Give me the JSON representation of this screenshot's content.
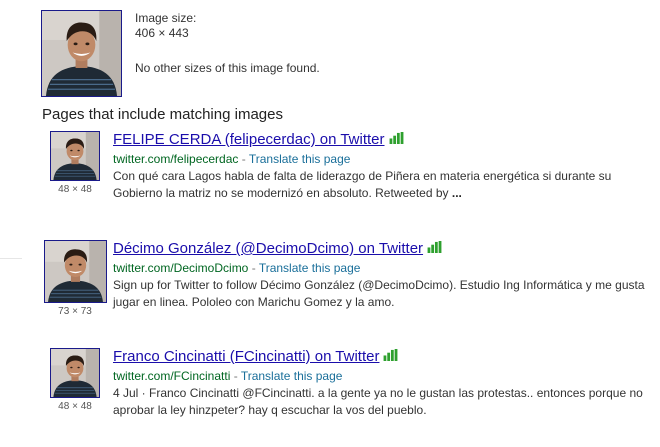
{
  "image_info": {
    "size_label": "Image size:",
    "dimensions": "406 × 443",
    "other_sizes": "No other sizes of this image found."
  },
  "section_title": "Pages that include matching images",
  "colors": {
    "link": "#1a0dab",
    "url_green": "#006621",
    "signal_green": "#2ea02e"
  },
  "icons": [
    "signal-bars-icon"
  ],
  "results": [
    {
      "title": "FELIPE CERDA (felipecerdac) on Twitter",
      "url": "twitter.com/felipecerdac",
      "separator": " - ",
      "translate": "Translate this page",
      "snippet": "Con qué cara Lagos habla de falta de liderazgo de Piñera en materia energética si durante su Gobierno la matriz no se modernizó en absoluto. Retweeted by",
      "ellipsis": " ...",
      "thumb_size": "48 × 48"
    },
    {
      "title": "Décimo González (@DecimoDcimo) on Twitter",
      "url": "twitter.com/DecimoDcimo",
      "separator": " - ",
      "translate": "Translate this page",
      "snippet": "Sign up for Twitter to follow Décimo González (@DecimoDcimo). Estudio Ing Informática y me gusta jugar en linea. Pololeo con Marichu Gomez y la amo.",
      "thumb_size": "73 × 73"
    },
    {
      "title": "Franco Cincinatti (FCincinatti) on Twitter",
      "url": "twitter.com/FCincinatti",
      "separator": " - ",
      "translate": "Translate this page",
      "snippet": "4 Jul · Franco Cincinatti @FCincinatti. a la gente ya no le gustan las protestas.. entonces porque no aprobar la ley hinzpeter? hay q escuchar la vos del pueblo.",
      "thumb_size": "48 × 48"
    }
  ]
}
